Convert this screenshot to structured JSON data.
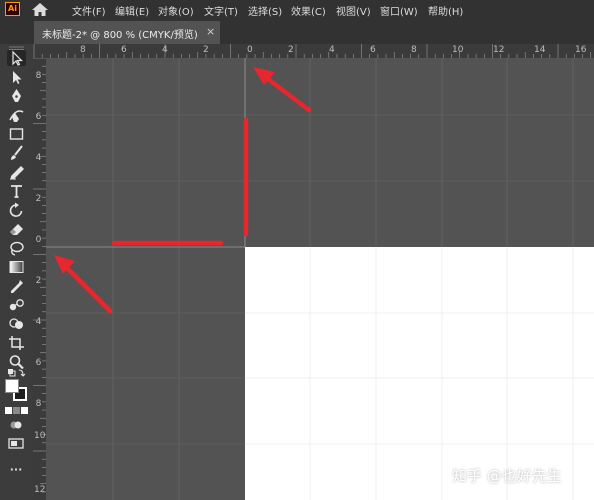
{
  "app": {
    "logo_text": "Ai"
  },
  "menu": [
    "文件(F)",
    "编辑(E)",
    "对象(O)",
    "文字(T)",
    "选择(S)",
    "效果(C)",
    "视图(V)",
    "窗口(W)",
    "帮助(H)"
  ],
  "document_tab": {
    "title": "未标题-2* @ 800 % (CMYK/预览)",
    "close": "×"
  },
  "rulers": {
    "horizontal_labels": [
      "8",
      "6",
      "4",
      "2",
      "0",
      "2",
      "4",
      "6",
      "8",
      "10",
      "12",
      "14",
      "16"
    ],
    "vertical_labels": [
      "8",
      "6",
      "4",
      "2",
      "0",
      "2",
      "4",
      "6",
      "8",
      "10",
      "12",
      "14"
    ]
  },
  "tools": [
    "selection-tool",
    "direct-selection-tool",
    "pen-tool",
    "curvature-tool",
    "rectangle-tool",
    "paintbrush-tool",
    "pencil-tool",
    "type-tool",
    "rotate-tool",
    "eraser-tool",
    "lasso-tool",
    "gradient-tool",
    "eyedropper-tool",
    "blend-tool",
    "shape-builder-tool",
    "artboard-tool",
    "zoom-tool",
    "swap-fill-stroke",
    "fill-stroke-swatch",
    "color-mode-buttons",
    "draw-mode",
    "screen-mode",
    "more-tools"
  ],
  "toolbar": {
    "more_label": "···"
  },
  "colors": {
    "pasteboard": "#535353",
    "artboard": "#ffffff",
    "annotation": "#e8262d",
    "ui_dark": "#323232"
  },
  "watermark": "知乎 @也好先生"
}
